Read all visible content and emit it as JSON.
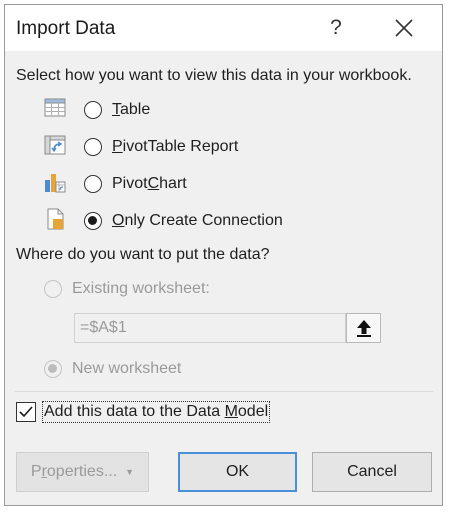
{
  "window": {
    "title": "Import Data",
    "help_glyph": "?",
    "close_icon": "close-icon"
  },
  "view_section": {
    "prompt": "Select how you want to view this data in your workbook.",
    "options": [
      {
        "label": "Table",
        "accesskey": "T",
        "icon": "table-icon",
        "checked": false
      },
      {
        "label": "PivotTable Report",
        "accesskey": "P",
        "icon": "pivottable-icon",
        "checked": false
      },
      {
        "label": "PivotChart",
        "accesskey": "C",
        "icon": "pivotchart-icon",
        "checked": false
      },
      {
        "label": "Only Create Connection",
        "accesskey": "O",
        "icon": "connection-file-icon",
        "checked": true
      }
    ]
  },
  "location_section": {
    "prompt": "Where do you want to put the data?",
    "existing_label": "Existing worksheet:",
    "existing_checked": false,
    "cell_reference": "=$A$1",
    "new_label": "New worksheet",
    "new_checked": true,
    "enabled": false
  },
  "data_model": {
    "label": "Add this data to the Data Model",
    "accesskey": "M",
    "checked": true
  },
  "buttons": {
    "properties": "Properties...",
    "properties_enabled": false,
    "ok": "OK",
    "cancel": "Cancel"
  },
  "colors": {
    "dialog_bg": "#f0f0f0",
    "titlebar_bg": "#ffffff",
    "ok_border": "#4a90d9",
    "disabled_text": "#9a9a9a",
    "icon_blue": "#4b8bd4",
    "icon_orange": "#e8a435"
  }
}
